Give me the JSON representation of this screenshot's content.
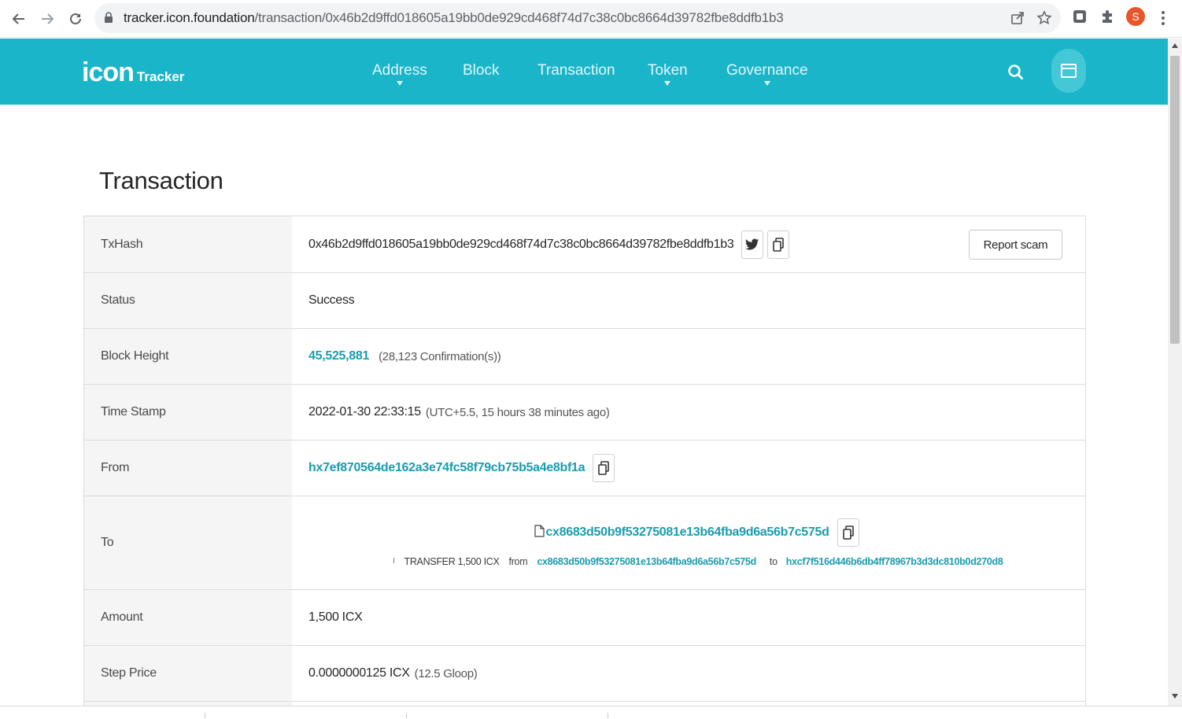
{
  "browser": {
    "url_host": "tracker.icon.foundation",
    "url_path": "/transaction/0x46b2d9ffd018605a19bb0de929cd468f74d7c38c0bc8664d39782fbe8ddfb1b3",
    "profile_initial": "S"
  },
  "header": {
    "logo_text": "icon",
    "logo_suffix": "Tracker",
    "nav": [
      {
        "label": "Address",
        "has_dropdown": true
      },
      {
        "label": "Block",
        "has_dropdown": false
      },
      {
        "label": "Transaction",
        "has_dropdown": false
      },
      {
        "label": "Token",
        "has_dropdown": true
      },
      {
        "label": "Governance",
        "has_dropdown": true
      }
    ],
    "brand_color": "#1ab5c8"
  },
  "page": {
    "title": "Transaction"
  },
  "details": {
    "txhash": {
      "label": "TxHash",
      "value": "0x46b2d9ffd018605a19bb0de929cd468f74d7c38c0bc8664d39782fbe8ddfb1b3",
      "report_label": "Report scam"
    },
    "status": {
      "label": "Status",
      "value": "Success"
    },
    "block_height": {
      "label": "Block Height",
      "value": "45,525,881",
      "confirmations": "(28,123 Confirmation(s))"
    },
    "time_stamp": {
      "label": "Time Stamp",
      "value": "2022-01-30 22:33:15",
      "relative": "(UTC+5.5, 15 hours 38 minutes ago)"
    },
    "from": {
      "label": "From",
      "value": "hx7ef870564de162a3e74fc58f79cb75b5a4e8bf1a"
    },
    "to": {
      "label": "To",
      "value": "cx8683d50b9f53275081e13b64fba9d6a56b7c575d",
      "transfer": {
        "text": "TRANSFER 1,500 ICX",
        "from_word": "from",
        "from_addr": "cx8683d50b9f53275081e13b64fba9d6a56b7c575d",
        "to_word": "to",
        "to_addr": "hxcf7f516d446b6db4ff78967b3d3dc810b0d270d8"
      }
    },
    "amount": {
      "label": "Amount",
      "value": "1,500 ICX"
    },
    "step_price": {
      "label": "Step Price",
      "value": "0.0000000125 ICX",
      "note": "(12.5 Gloop)"
    }
  }
}
